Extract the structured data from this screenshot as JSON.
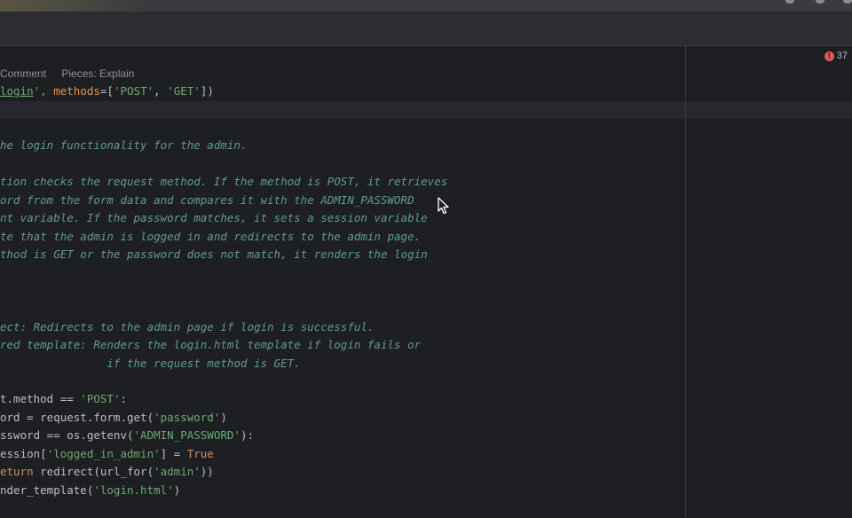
{
  "editor": {
    "hints": [
      "Comment",
      "Pieces: Explain"
    ],
    "error_count": "37",
    "lines": [
      [
        {
          "t": "login",
          "c": "str udl"
        },
        {
          "t": "', ",
          "c": "str"
        },
        {
          "t": "methods",
          "c": "param"
        },
        {
          "t": "=[",
          "c": ""
        },
        {
          "t": "'POST'",
          "c": "str"
        },
        {
          "t": ", ",
          "c": ""
        },
        {
          "t": "'GET'",
          "c": "str"
        },
        {
          "t": "])",
          "c": ""
        }
      ],
      [],
      [],
      [
        {
          "t": "he login functionality for the admin.",
          "c": "cm"
        }
      ],
      [],
      [
        {
          "t": "tion checks the request method. If the method is POST, it retrieves",
          "c": "cm"
        }
      ],
      [
        {
          "t": "ord from the form data and compares it with the ADMIN_PASSWORD",
          "c": "cm"
        }
      ],
      [
        {
          "t": "nt variable. If the password matches, it sets a session variable",
          "c": "cm"
        }
      ],
      [
        {
          "t": "te that the admin is logged in and redirects to the admin page.",
          "c": "cm"
        }
      ],
      [
        {
          "t": "thod is GET or the password does not match, it renders the login",
          "c": "cm"
        }
      ],
      [],
      [],
      [],
      [
        {
          "t": "ect: Redirects to the admin page if login is successful.",
          "c": "cm"
        }
      ],
      [
        {
          "t": "red template: Renders the login.html template if login fails or",
          "c": "cm"
        }
      ],
      [
        {
          "t": "                if the request method is GET.",
          "c": "cm"
        }
      ],
      [],
      [
        {
          "t": "t.method == ",
          "c": ""
        },
        {
          "t": "'POST'",
          "c": "str"
        },
        {
          "t": ":",
          "c": ""
        }
      ],
      [
        {
          "t": "ord = request.form.get(",
          "c": ""
        },
        {
          "t": "'password'",
          "c": "str"
        },
        {
          "t": ")",
          "c": ""
        }
      ],
      [
        {
          "t": "ssword == os.getenv(",
          "c": ""
        },
        {
          "t": "'ADMIN_PASSWORD'",
          "c": "str"
        },
        {
          "t": "):",
          "c": ""
        }
      ],
      [
        {
          "t": "ession[",
          "c": ""
        },
        {
          "t": "'logged_in_admin'",
          "c": "str"
        },
        {
          "t": "] = ",
          "c": ""
        },
        {
          "t": "True",
          "c": "kw"
        }
      ],
      [
        {
          "t": "eturn ",
          "c": "kw"
        },
        {
          "t": "redirect(url_for(",
          "c": ""
        },
        {
          "t": "'admin'",
          "c": "str"
        },
        {
          "t": "))",
          "c": ""
        }
      ],
      [
        {
          "t": "nder_template(",
          "c": ""
        },
        {
          "t": "'login.html'",
          "c": "str"
        },
        {
          "t": ")",
          "c": ""
        }
      ]
    ]
  }
}
